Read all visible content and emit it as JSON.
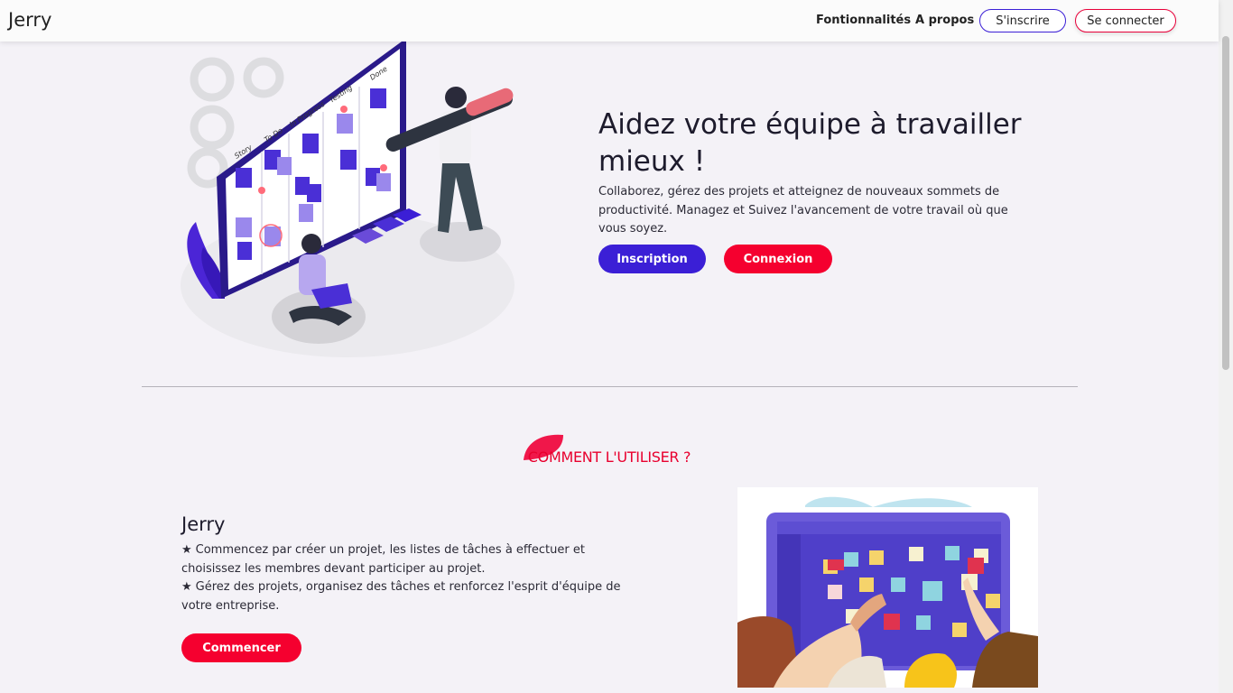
{
  "nav": {
    "brand": "Jerry",
    "links": [
      "Fontionnalités",
      "A propos"
    ],
    "signup_label": "S'inscrire",
    "login_label": "Se connecter"
  },
  "hero": {
    "title": "Aidez votre équipe à travailler mieux !",
    "text": "Collaborez, gérez des projets et atteignez de nouveaux sommets de productivité. Managez et Suivez l'avancement de votre travail où que vous soyez.",
    "primary_button": "Inscription",
    "secondary_button": "Connexion",
    "board_columns": [
      "Story",
      "To Do",
      "In Progress",
      "Testing",
      "Done"
    ]
  },
  "how": {
    "section_title": "COMMENT L'UTILISER ?",
    "title": "Jerry",
    "steps": [
      "Commencez par créer un projet, les listes de tâches à effectuer et choisissez les membres devant participer au projet.",
      "Gérez des projets, organisez des tâches et renforcez l'esprit d'équipe de votre entreprise."
    ],
    "button": "Commencer"
  },
  "colors": {
    "primary": "#3b1fd6",
    "danger": "#f5002f",
    "background": "#f4f2f7"
  },
  "icons": [
    "star-icon",
    "kanban-board-illustration",
    "sticky-notes-illustration"
  ]
}
